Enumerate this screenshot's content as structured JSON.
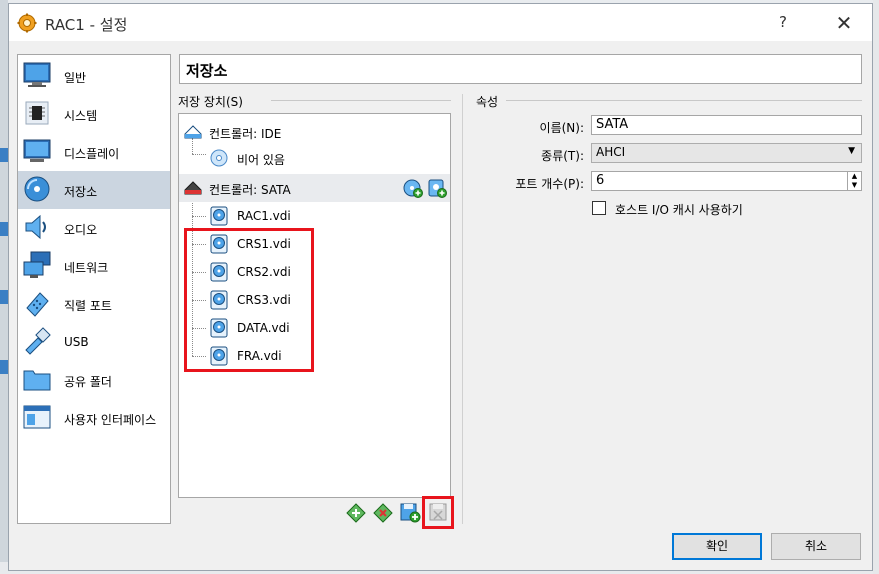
{
  "window": {
    "title": "RAC1 - 설정",
    "help": "?",
    "close": "✕"
  },
  "sidebar": {
    "items": [
      {
        "label": "일반"
      },
      {
        "label": "시스템"
      },
      {
        "label": "디스플레이"
      },
      {
        "label": "저장소"
      },
      {
        "label": "오디오"
      },
      {
        "label": "네트워크"
      },
      {
        "label": "직렬 포트"
      },
      {
        "label": "USB"
      },
      {
        "label": "공유 폴더"
      },
      {
        "label": "사용자 인터페이스"
      }
    ],
    "active_index": 3
  },
  "page": {
    "heading": "저장소"
  },
  "storage_tree": {
    "group_title": "저장 장치(S)",
    "controllers": [
      {
        "label": "컨트롤러: IDE",
        "children": [
          {
            "label": "비어 있음"
          }
        ]
      },
      {
        "label": "컨트롤러: SATA",
        "children": [
          {
            "label": "RAC1.vdi"
          },
          {
            "label": "CRS1.vdi"
          },
          {
            "label": "CRS2.vdi"
          },
          {
            "label": "CRS3.vdi"
          },
          {
            "label": "DATA.vdi"
          },
          {
            "label": "FRA.vdi"
          }
        ]
      }
    ],
    "selected": "컨트롤러: SATA"
  },
  "attributes": {
    "group_title": "속성",
    "name_label": "이름(N):",
    "name_value": "SATA",
    "type_label": "종류(T):",
    "type_value": "AHCI",
    "port_label": "포트 개수(P):",
    "port_value": "6",
    "cache_label": "호스트 I/O 캐시 사용하기",
    "cache_checked": false
  },
  "buttons": {
    "ok": "확인",
    "cancel": "취소"
  },
  "colors": {
    "highlight_box": "#e8141c",
    "selected_sidebar": "#cbd5e0",
    "primary_border": "#0078d7"
  }
}
